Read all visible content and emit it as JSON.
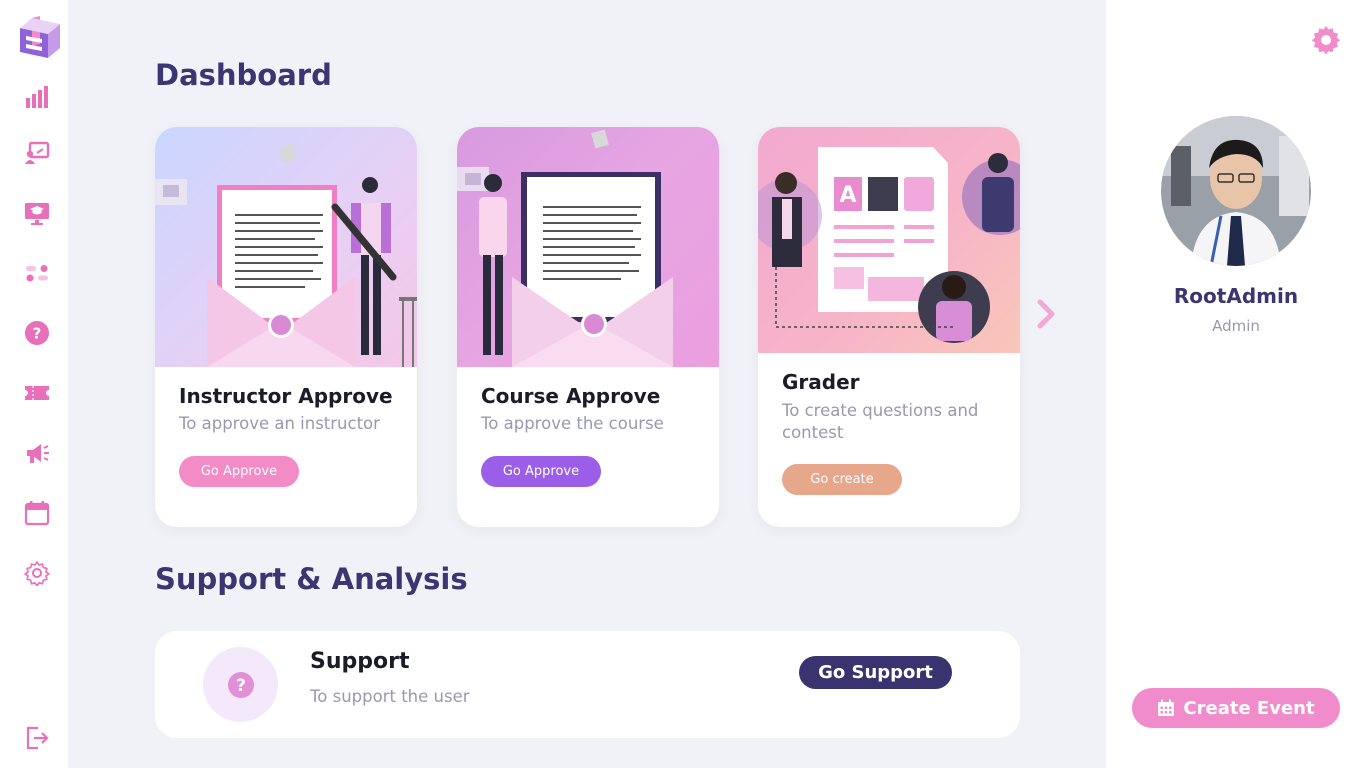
{
  "sidebar": {
    "logo": "logo-mark",
    "items": [
      {
        "icon": "bar-chart-icon"
      },
      {
        "icon": "instructor-board-icon"
      },
      {
        "icon": "course-screen-icon"
      },
      {
        "icon": "toggles-icon"
      },
      {
        "icon": "question-icon"
      },
      {
        "icon": "ticket-icon"
      },
      {
        "icon": "megaphone-icon"
      },
      {
        "icon": "calendar-icon"
      },
      {
        "icon": "settings-icon"
      }
    ],
    "logout_icon": "logout-icon"
  },
  "main": {
    "dashboard_title": "Dashboard",
    "cards": [
      {
        "title": "Instructor Approve",
        "subtitle": "To approve an instructor",
        "button": "Go Approve",
        "button_color": "#f28bc6"
      },
      {
        "title": "Course Approve",
        "subtitle": "To approve the course",
        "button": "Go Approve",
        "button_color": "#9b5ee8"
      },
      {
        "title": "Grader",
        "subtitle": "To create questions and contest",
        "button": "Go create",
        "button_color": "#e6a78a"
      }
    ],
    "support_section_title": "Support & Analysis",
    "support": {
      "title": "Support",
      "subtitle": "To support the user",
      "button": "Go Support"
    }
  },
  "right_panel": {
    "user_name": "RootAdmin",
    "user_role": "Admin",
    "create_event_label": "Create Event"
  },
  "colors": {
    "primary_dark": "#3b3572",
    "accent_pink": "#f08ccc",
    "background": "#f1f2f7"
  }
}
